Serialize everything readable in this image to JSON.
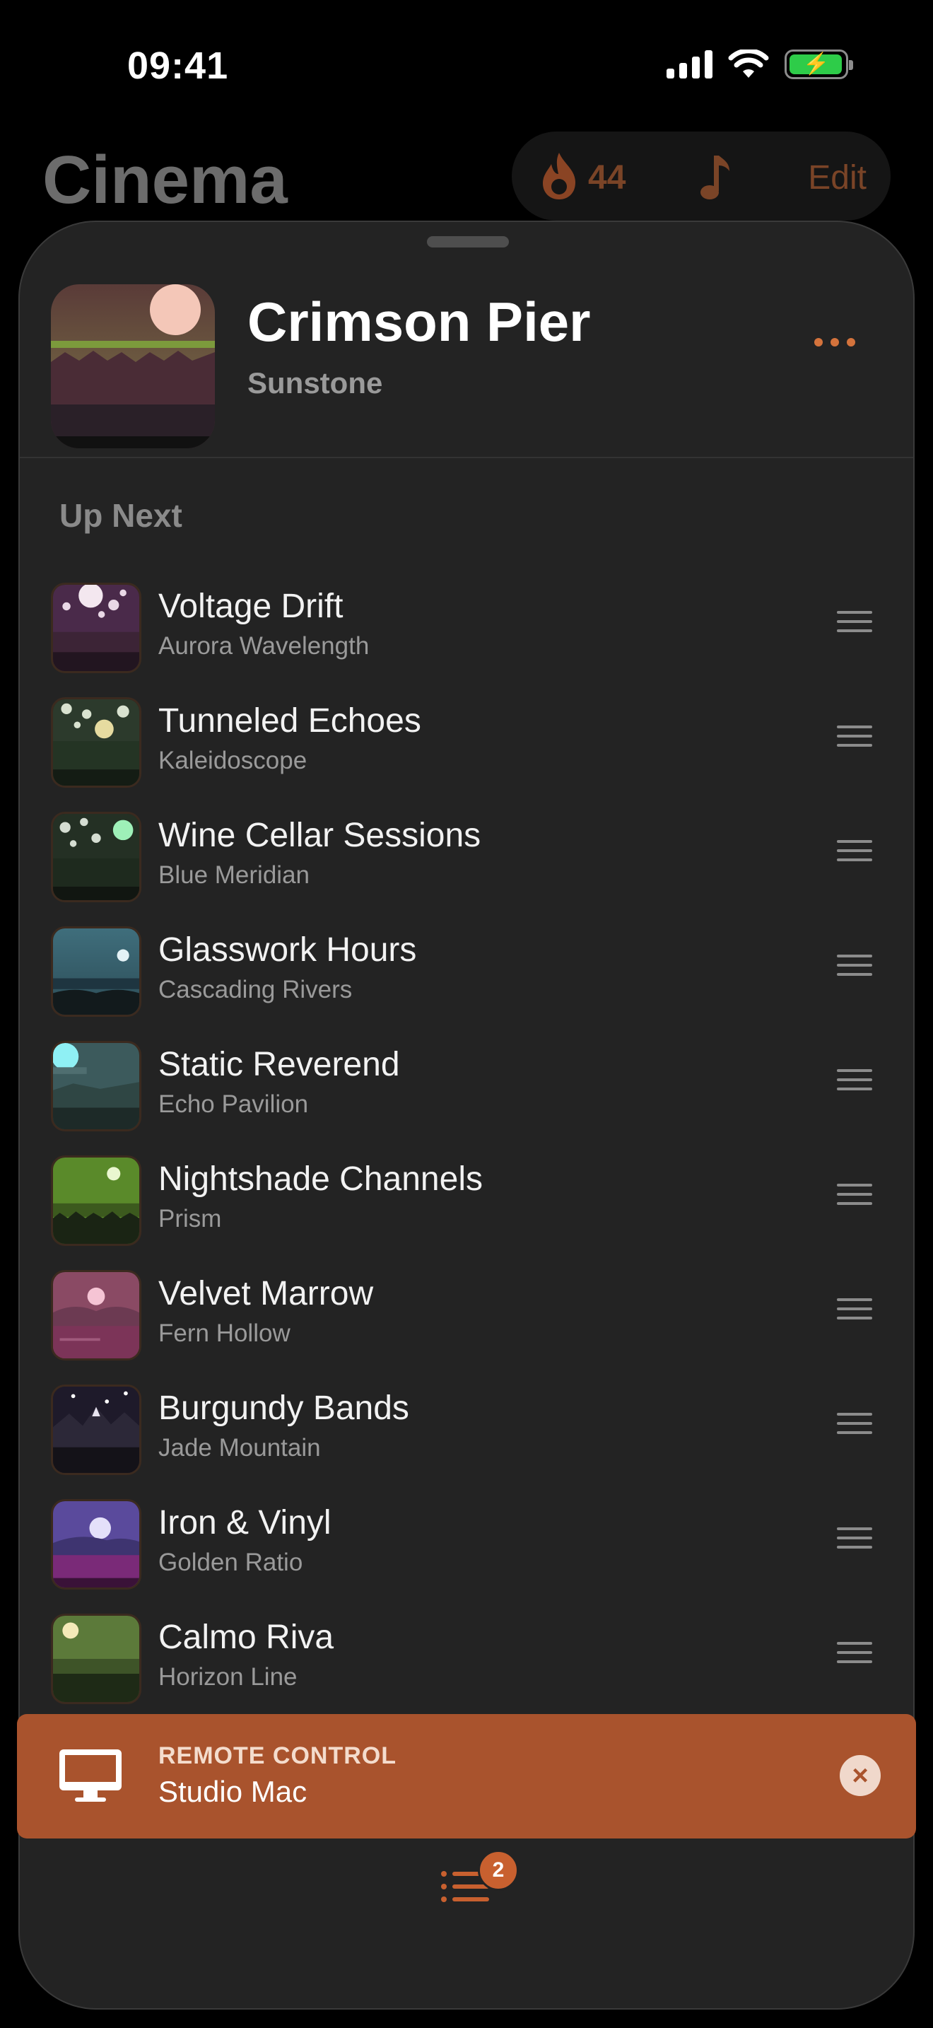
{
  "status_bar": {
    "time": "09:41"
  },
  "background": {
    "title": "Cinema",
    "streak_count": "44",
    "edit_label": "Edit"
  },
  "now_playing": {
    "title": "Crimson Pier",
    "artist": "Sunstone"
  },
  "queue": {
    "heading": "Up Next",
    "items": [
      {
        "title": "Voltage Drift",
        "artist": "Aurora Wavelength"
      },
      {
        "title": "Tunneled Echoes",
        "artist": "Kaleidoscope"
      },
      {
        "title": "Wine Cellar Sessions",
        "artist": "Blue Meridian"
      },
      {
        "title": "Glasswork Hours",
        "artist": "Cascading Rivers"
      },
      {
        "title": "Static Reverend",
        "artist": "Echo Pavilion"
      },
      {
        "title": "Nightshade Channels",
        "artist": "Prism"
      },
      {
        "title": "Velvet Marrow",
        "artist": "Fern Hollow"
      },
      {
        "title": "Burgundy Bands",
        "artist": "Jade Mountain"
      },
      {
        "title": "Iron & Vinyl",
        "artist": "Golden Ratio"
      },
      {
        "title": "Calmo Riva",
        "artist": "Horizon Line"
      }
    ]
  },
  "remote": {
    "kicker": "REMOTE CONTROL",
    "device": "Studio Mac"
  },
  "tab": {
    "queue_badge": "2"
  },
  "colors": {
    "accent": "#d4733c",
    "banner": "#a9532d"
  }
}
